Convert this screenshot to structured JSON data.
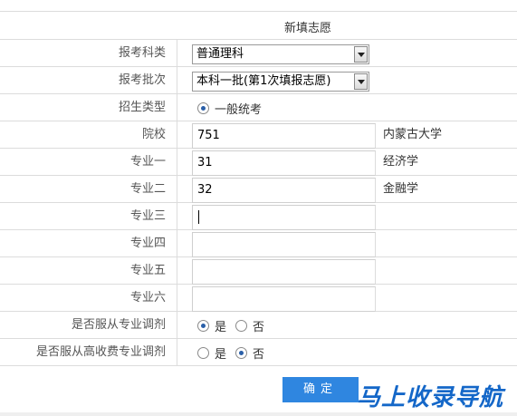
{
  "form": {
    "title": "新填志愿",
    "category": {
      "label": "报考科类",
      "selected": "普通理科"
    },
    "batch": {
      "label": "报考批次",
      "selected": "本科一批(第1次填报志愿)"
    },
    "enroll_type": {
      "label": "招生类型",
      "option": "一般统考"
    },
    "school": {
      "label": "院校",
      "value": "751",
      "name": "内蒙古大学"
    },
    "majors": [
      {
        "label": "专业一",
        "value": "31",
        "name": "经济学"
      },
      {
        "label": "专业二",
        "value": "32",
        "name": "金融学"
      },
      {
        "label": "专业三",
        "value": ""
      },
      {
        "label": "专业四",
        "value": ""
      },
      {
        "label": "专业五",
        "value": ""
      },
      {
        "label": "专业六",
        "value": ""
      }
    ],
    "adjust": {
      "label": "是否服从专业调剂",
      "yes": "是",
      "no": "否",
      "selected": "yes"
    },
    "adjust_high_fee": {
      "label": "是否服从高收费专业调剂",
      "yes": "是",
      "no": "否",
      "selected": "no"
    },
    "confirm_label": "确定"
  },
  "watermark": "马上收录导航"
}
